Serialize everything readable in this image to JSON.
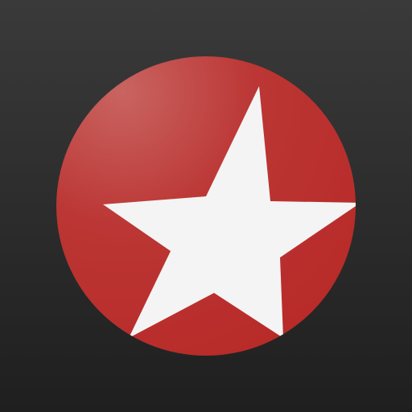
{
  "icon": {
    "name": "red-circle-white-star-app-icon",
    "background_color_top": "#3a3a3a",
    "background_color_bottom": "#1f1f1f",
    "circle_color": "#b82a28",
    "circle_highlight_color": "#c96461",
    "star_color": "#f4f4f4"
  }
}
